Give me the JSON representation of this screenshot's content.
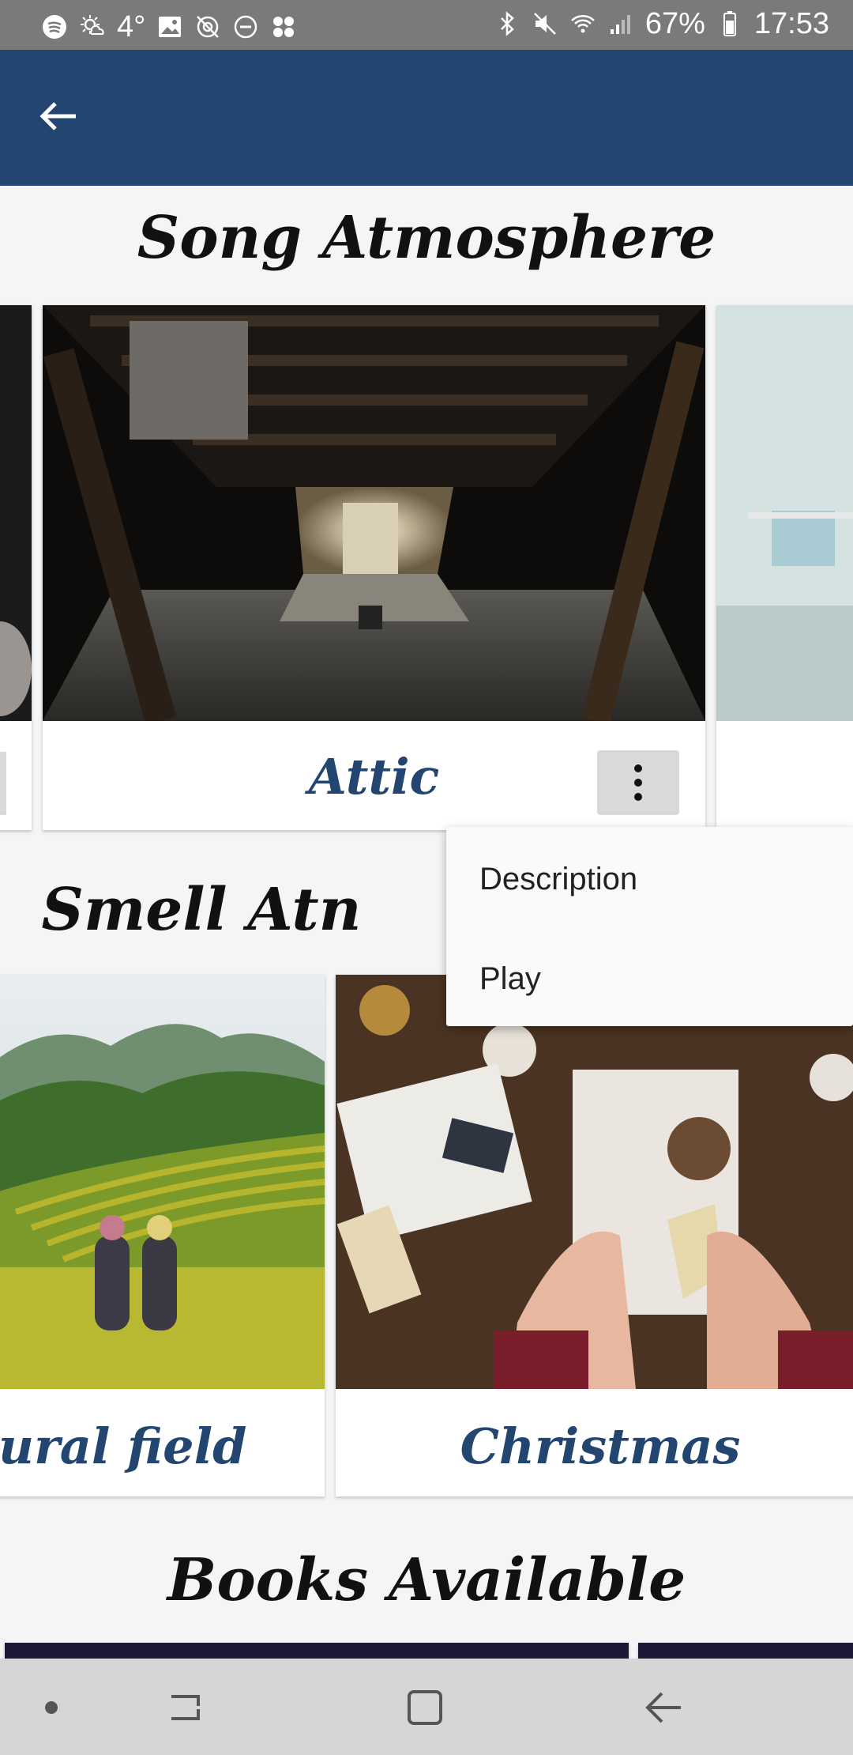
{
  "status_bar": {
    "temperature": "4°",
    "battery": "67%",
    "time": "17:53",
    "icons_left": [
      "spotify-icon",
      "weather-icon",
      "image-icon",
      "no-location-icon",
      "do-not-disturb-icon",
      "apps-icon"
    ],
    "icons_right": [
      "bluetooth-icon",
      "mute-icon",
      "wifi-icon",
      "signal-icon",
      "battery-icon"
    ]
  },
  "app_bar": {
    "color": "#234670",
    "back_icon": "arrow-back-icon"
  },
  "sections": {
    "song": {
      "title": "Song Atmosphere",
      "cards": [
        {
          "label": "Attic"
        }
      ]
    },
    "smell": {
      "title": "Smell Atn",
      "cards": [
        {
          "label": "ural field"
        },
        {
          "label": "Christmas"
        }
      ]
    },
    "books": {
      "title": "Books Available"
    }
  },
  "context_menu": {
    "items": [
      {
        "label": "Description"
      },
      {
        "label": "Play"
      }
    ]
  },
  "nav_bar": {
    "buttons": [
      "dot-icon",
      "recent-apps-icon",
      "home-icon",
      "back-icon"
    ]
  }
}
